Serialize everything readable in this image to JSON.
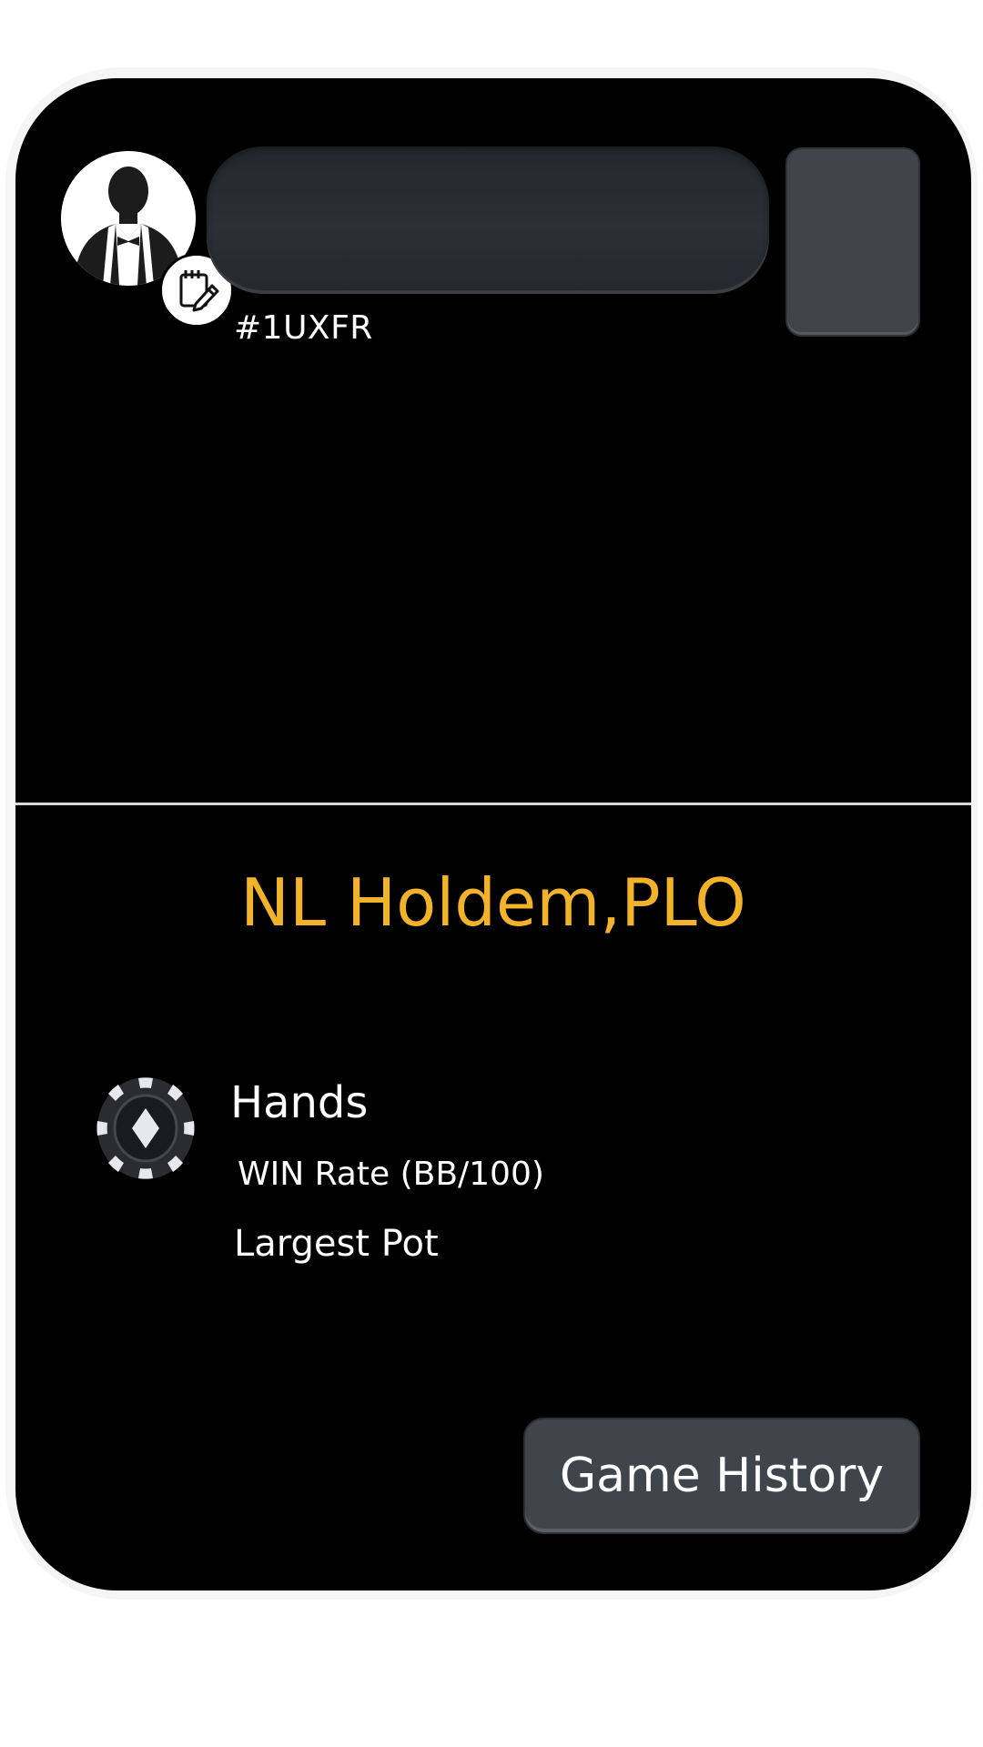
{
  "profile": {
    "avatar_icon": "person-silhouette-icon",
    "edit_icon": "edit-notepad-icon",
    "name_value": "",
    "player_id": "#1UXFR"
  },
  "stats": {
    "game_types": "NL Holdem,PLO",
    "chip_icon": "poker-chip-icon",
    "hands_label": "Hands",
    "win_rate_label": "WIN Rate (BB/100)",
    "largest_pot_label": "Largest Pot"
  },
  "actions": {
    "game_history_label": "Game History"
  },
  "colors": {
    "card_background": "#000000",
    "accent": "#f2b32a",
    "button": "#40444b",
    "input": "#2a2d32",
    "text": "#ffffff"
  }
}
